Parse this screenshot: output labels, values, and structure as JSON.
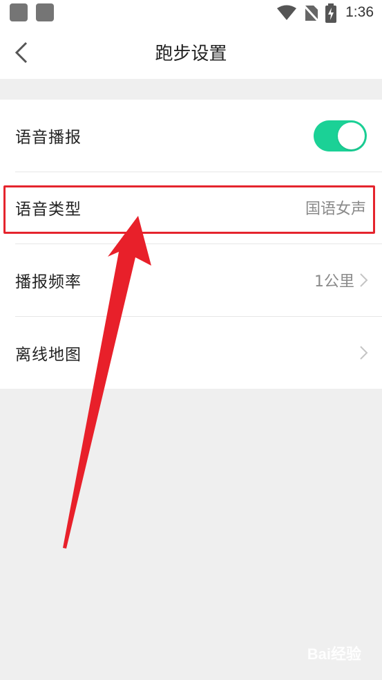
{
  "status_bar": {
    "time": "1:36"
  },
  "nav": {
    "title": "跑步设置"
  },
  "settings": {
    "voice_broadcast": {
      "label": "语音播报",
      "enabled": true
    },
    "voice_type": {
      "label": "语音类型",
      "value": "国语女声"
    },
    "broadcast_frequency": {
      "label": "播报频率",
      "value": "1公里"
    },
    "offline_map": {
      "label": "离线地图"
    }
  },
  "colors": {
    "accent": "#1bd196",
    "annotation": "#e5242d",
    "background": "#efefef"
  },
  "watermark": {
    "text": "Bai经验"
  }
}
